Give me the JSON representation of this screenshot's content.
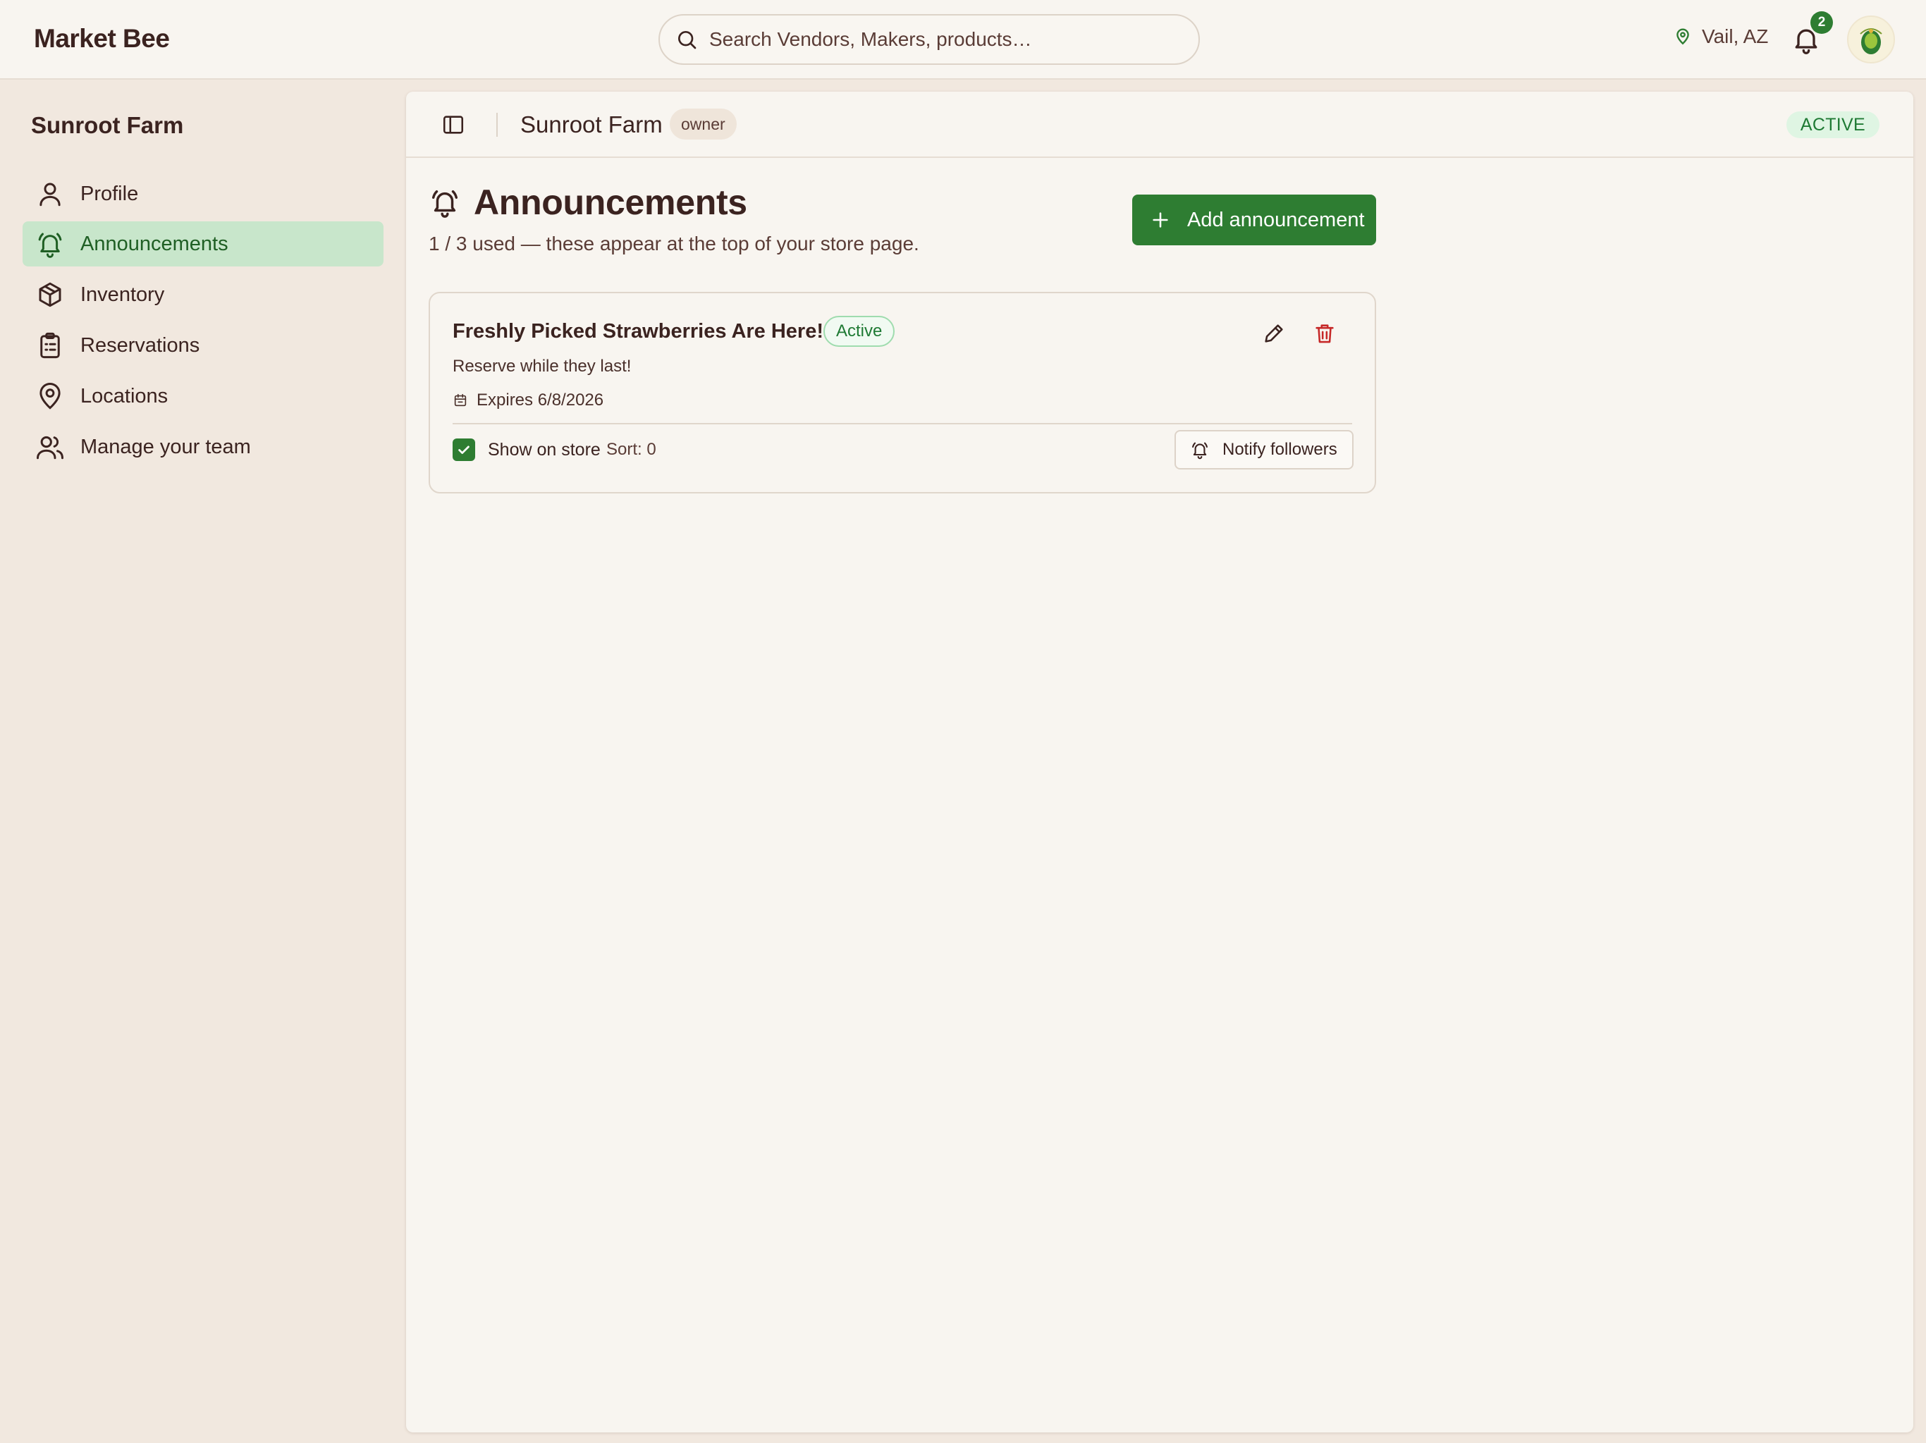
{
  "app": {
    "brand": "Market Bee",
    "search_placeholder": "Search Vendors, Makers, products…",
    "location": "Vail, AZ",
    "notification_count": "2"
  },
  "sidebar": {
    "title": "Sunroot Farm",
    "items": [
      {
        "label": "Profile",
        "icon": "user-icon"
      },
      {
        "label": "Announcements",
        "icon": "bell-icon",
        "active": true
      },
      {
        "label": "Inventory",
        "icon": "box-icon"
      },
      {
        "label": "Reservations",
        "icon": "clipboard-icon"
      },
      {
        "label": "Locations",
        "icon": "map-pin-icon"
      },
      {
        "label": "Manage your team",
        "icon": "users-icon"
      }
    ]
  },
  "header": {
    "title": "Sunroot Farm",
    "role": "owner",
    "status": "ACTIVE"
  },
  "page": {
    "title": "Announcements",
    "subtitle": "1 / 3 used — these appear at the top of your store page.",
    "add_button": "Add announcement"
  },
  "announcements": [
    {
      "title": "Freshly Picked Strawberries Are Here!",
      "status": "Active",
      "description": "Reserve while they last!",
      "expires": "Expires 6/8/2026",
      "show_on_store_label": "Show on store",
      "show_on_store": true,
      "sort": "Sort: 0",
      "notify_label": "Notify followers"
    }
  ],
  "colors": {
    "accent": "#2e7d32",
    "text": "#3b2320",
    "sidebar_bg": "#f1e8df",
    "panel_bg": "#f8f5f0",
    "active_nav_bg": "#c8e6cb",
    "danger": "#c62828"
  }
}
